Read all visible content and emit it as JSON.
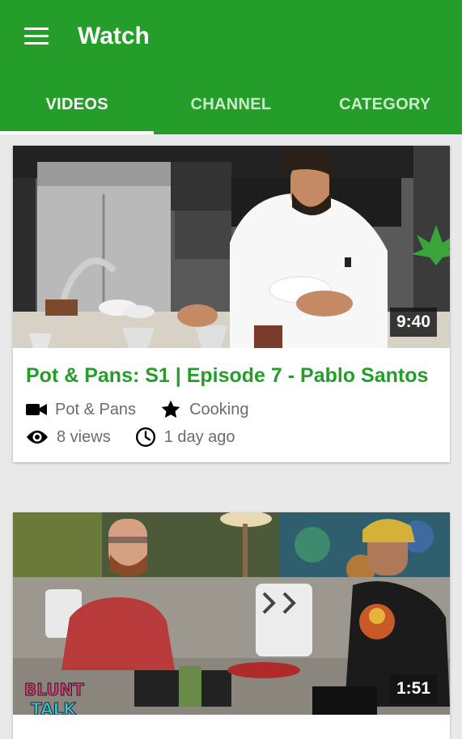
{
  "app": {
    "title": "Watch"
  },
  "tabs": [
    {
      "label": "VIDEOS",
      "active": true
    },
    {
      "label": "CHANNEL",
      "active": false
    },
    {
      "label": "CATEGORY",
      "active": false
    }
  ],
  "videos": [
    {
      "title": "Pot & Pans: S1 | Episode 7 - Pablo Santos",
      "channel": "Pot & Pans",
      "category": "Cooking",
      "views": "8 views",
      "age": "1 day ago",
      "duration": "9:40",
      "channel_icon": "video-camera-icon",
      "category_icon": "star-icon"
    },
    {
      "title": "",
      "duration": "1:51",
      "thumbnail_logo": "BLUNT TALK"
    }
  ],
  "colors": {
    "primary": "#249d29",
    "indicator": "#ffffff",
    "meta_text": "#6c6c6c"
  }
}
